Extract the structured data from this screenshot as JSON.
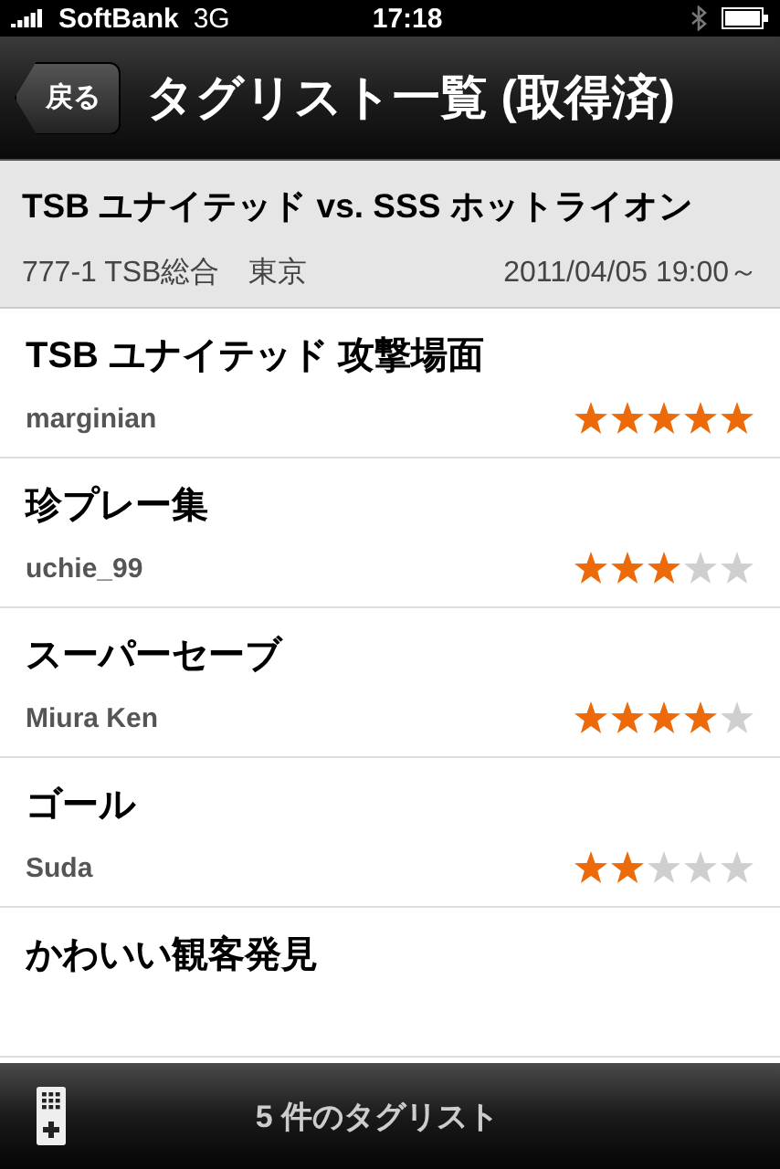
{
  "status_bar": {
    "carrier": "SoftBank",
    "network": "3G",
    "time": "17:18"
  },
  "nav_bar": {
    "back": "戻る",
    "title": "タグリスト一覧 (取得済)"
  },
  "match": {
    "title": "TSB ユナイテッド vs. SSS ホットライオン",
    "channel": "777-1 TSB総合　東京",
    "datetime": "2011/04/05 19:00～"
  },
  "items": [
    {
      "title": "TSB ユナイテッド 攻撃場面",
      "author": "marginian",
      "stars": 5
    },
    {
      "title": "珍プレー集",
      "author": "uchie_99",
      "stars": 3
    },
    {
      "title": "スーパーセーブ",
      "author": "Miura Ken",
      "stars": 4
    },
    {
      "title": "ゴール",
      "author": "Suda",
      "stars": 2
    },
    {
      "title": "かわいい観客発見"
    }
  ],
  "footer": {
    "count": "5 件のタグリスト"
  }
}
